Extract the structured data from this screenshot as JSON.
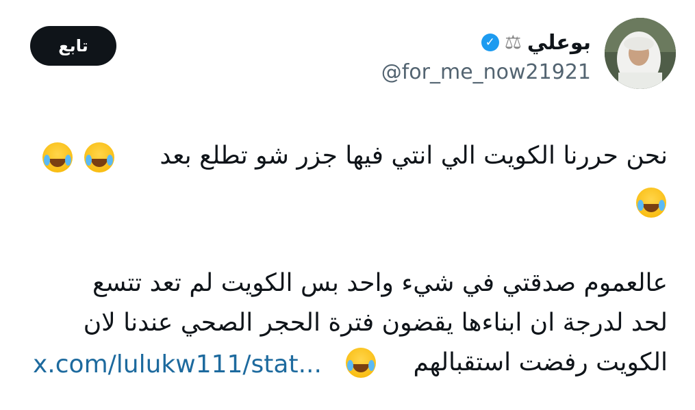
{
  "user": {
    "display_name": "بوعلي",
    "handle": "@for_me_now21921",
    "scales_icon": "scales-icon",
    "verified_icon": "verified-badge-icon",
    "verified_mark": "✓",
    "scales_glyph": "⚖"
  },
  "follow_button": {
    "label": "تابع"
  },
  "tweet": {
    "line1": "نحن حررنا الكويت الي انتي فيها جزر شو تطلع بعد",
    "line2": "عالعموم صدقتي في شيء واحد بس الكويت لم تعد تتسع",
    "line3": "لحد لدرجة ان ابناءها يقضون فترة الحجر الصحي عندنا لان",
    "line4": "الكويت رفضت استقبالهم",
    "link": "x.com/lulukw111/stat...",
    "emoji": "face-with-tears-of-joy-icon"
  }
}
